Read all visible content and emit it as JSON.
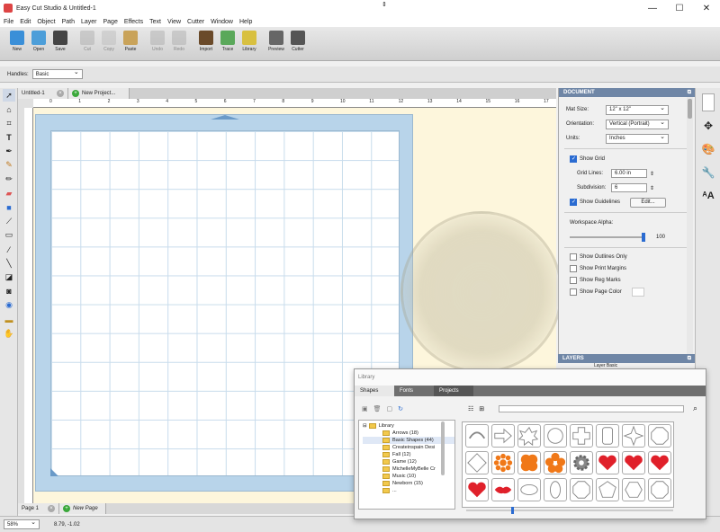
{
  "window": {
    "title": "Easy Cut Studio & Untitled-1",
    "min": "—",
    "max": "☐",
    "close": "✕"
  },
  "menu": [
    "File",
    "Edit",
    "Object",
    "Path",
    "Layer",
    "Page",
    "Effects",
    "Text",
    "View",
    "Cutter",
    "Window",
    "Help"
  ],
  "toolbar": {
    "buttons": [
      {
        "label": "New",
        "icon": "new-document-icon",
        "color": "#3a8fd8"
      },
      {
        "label": "Open",
        "icon": "open-folder-icon",
        "color": "#4c9ed9"
      },
      {
        "label": "Save",
        "icon": "save-disk-icon",
        "color": "#444"
      },
      {
        "label": "Cut",
        "icon": "scissors-icon",
        "color": "#aaa"
      },
      {
        "label": "Copy",
        "icon": "copy-icon",
        "color": "#bbb"
      },
      {
        "label": "Paste",
        "icon": "paste-icon",
        "color": "#c9a35a"
      },
      {
        "label": "Undo",
        "icon": "undo-icon",
        "color": "#aaa"
      },
      {
        "label": "Redo",
        "icon": "redo-icon",
        "color": "#aaa"
      },
      {
        "label": "Import",
        "icon": "import-image-icon",
        "color": "#6a4a2a"
      },
      {
        "label": "Trace",
        "icon": "trace-icon",
        "color": "#5aa85a"
      },
      {
        "label": "Library",
        "icon": "library-icon",
        "color": "#d8c040"
      },
      {
        "label": "Preview",
        "icon": "preview-magnifier-icon",
        "color": "#666"
      },
      {
        "label": "Cutter",
        "icon": "cutter-icon",
        "color": "#555"
      }
    ]
  },
  "options": {
    "handles_label": "Handles:",
    "handles_value": "Basic"
  },
  "tabs": {
    "doc": "Untitled-1",
    "new_project": "New Project..."
  },
  "ruler_ticks": [
    "0",
    "1",
    "2",
    "3",
    "4",
    "5",
    "6",
    "7",
    "8",
    "9",
    "10",
    "11",
    "12",
    "13",
    "14",
    "15",
    "16",
    "17"
  ],
  "document_panel": {
    "header": "DOCUMENT",
    "mat_size_label": "Mat Size:",
    "mat_size": "12\" x 12\"",
    "orientation_label": "Orientation:",
    "orientation": "Vertical (Portrait)",
    "units_label": "Units:",
    "units": "Inches",
    "show_grid": "Show Grid",
    "grid_lines_label": "Grid Lines:",
    "grid_lines": "6.00 in",
    "subdivision_label": "Subdivision:",
    "subdivision": "6",
    "show_guidelines": "Show Guidelines",
    "edit_button": "Edit...",
    "alpha_label": "Workspace Alpha:",
    "alpha_value": "100",
    "show_outlines": "Show Outlines Only",
    "show_margins": "Show Print Margins",
    "show_reg": "Show Reg Marks",
    "show_page_color": "Show Page Color"
  },
  "layers_panel": {
    "header": "LAYERS",
    "item": "Layer Basic"
  },
  "library": {
    "title": "Library",
    "tabs": [
      "Shapes",
      "Fonts",
      "Projects"
    ],
    "tree_root": "Library",
    "tree_items": [
      "Arrows (18)",
      "Basic Shapes (44)",
      "Createinspain Desi",
      "Fall (12)",
      "Game (12)",
      "MichelleMyBelle Cr",
      "Music (10)",
      "Newborn (15)",
      "..."
    ]
  },
  "page_tabs": {
    "page1": "Page 1",
    "new_page": "New Page"
  },
  "status": {
    "zoom": "58%",
    "coords": "8.79, -1.02"
  },
  "colors": {
    "panel_header": "#6f86a6",
    "mat": "#b8d4ea",
    "cream": "#fdf6dc",
    "red": "#e0202a",
    "orange": "#f07818"
  }
}
